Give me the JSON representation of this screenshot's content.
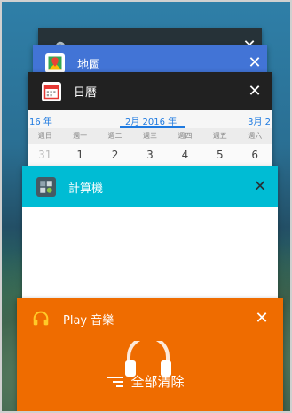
{
  "settings_card": {
    "title": "",
    "icon": "gear-icon"
  },
  "maps_card": {
    "title": "地圖",
    "icon": "maps-icon",
    "color": "#4274d6"
  },
  "calendar_card": {
    "title": "日曆",
    "icon": "calendar-icon",
    "month_prev": "16 年",
    "month_current": "2月 2016 年",
    "month_next": "3月 2",
    "weekdays": [
      "週日",
      "週一",
      "週二",
      "週三",
      "週四",
      "週五",
      "週六"
    ],
    "dates": [
      "31",
      "1",
      "2",
      "3",
      "4",
      "5",
      "6"
    ]
  },
  "calculator_card": {
    "title": "計算機",
    "icon": "calculator-icon",
    "color": "#00bcd4"
  },
  "music_card": {
    "title": "Play 音樂",
    "icon": "headphones-icon",
    "color": "#ef6c00"
  },
  "clear_all": {
    "label": "全部清除",
    "icon": "clear-all-icon"
  }
}
